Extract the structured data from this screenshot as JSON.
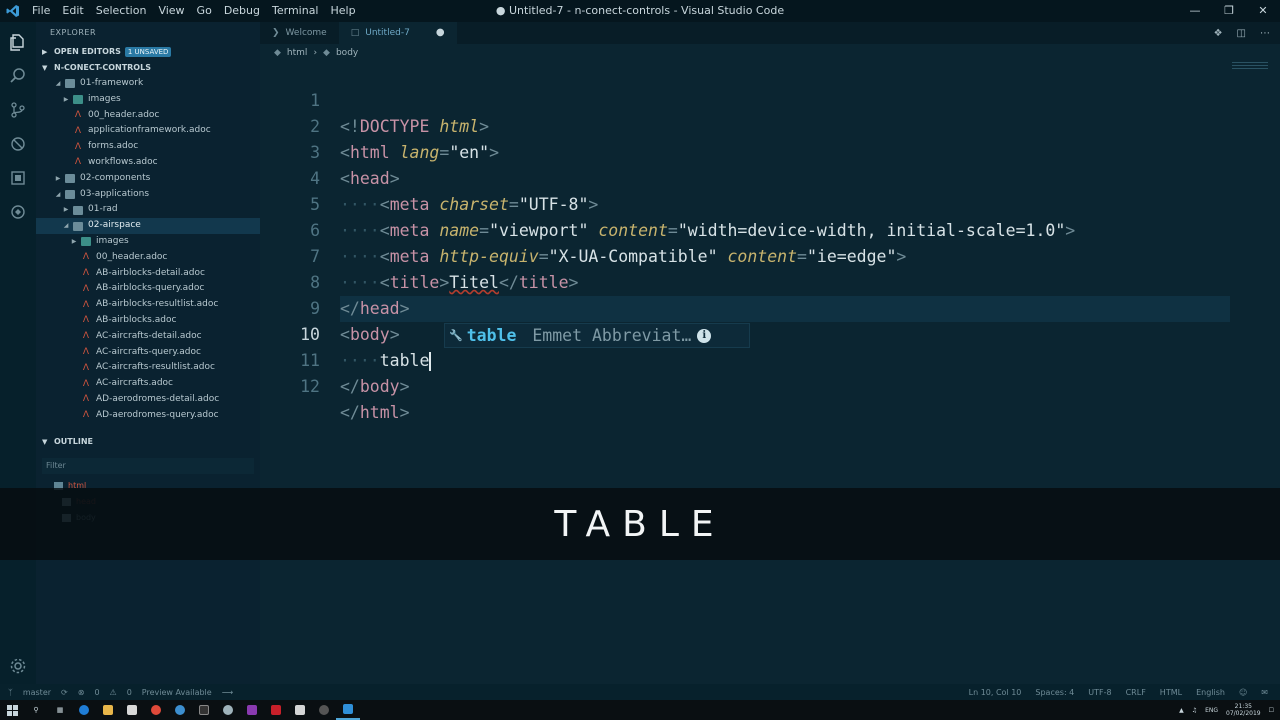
{
  "window": {
    "title": "● Untitled-7 - n-conect-controls - Visual Studio Code",
    "menu": [
      "File",
      "Edit",
      "Selection",
      "View",
      "Go",
      "Debug",
      "Terminal",
      "Help"
    ]
  },
  "sidebar": {
    "header": "EXPLORER",
    "open_editors": "OPEN EDITORS",
    "unsaved_badge": "1 UNSAVED",
    "project": "N-CONECT-CONTROLS",
    "tree": [
      {
        "label": "01-framework",
        "kind": "folder",
        "level": 1,
        "expanded": true
      },
      {
        "label": "images",
        "kind": "img-folder",
        "level": 2,
        "expanded": false
      },
      {
        "label": "00_header.adoc",
        "kind": "adoc",
        "level": 2
      },
      {
        "label": "applicationframework.adoc",
        "kind": "adoc",
        "level": 2
      },
      {
        "label": "forms.adoc",
        "kind": "adoc",
        "level": 2
      },
      {
        "label": "workflows.adoc",
        "kind": "adoc",
        "level": 2
      },
      {
        "label": "02-components",
        "kind": "folder",
        "level": 1,
        "expanded": false
      },
      {
        "label": "03-applications",
        "kind": "folder",
        "level": 1,
        "expanded": true
      },
      {
        "label": "01-rad",
        "kind": "folder",
        "level": 2,
        "expanded": false
      },
      {
        "label": "02-airspace",
        "kind": "folder",
        "level": 2,
        "expanded": true,
        "selected": true
      },
      {
        "label": "images",
        "kind": "img-folder",
        "level": 3,
        "expanded": false
      },
      {
        "label": "00_header.adoc",
        "kind": "adoc",
        "level": 3
      },
      {
        "label": "AB-airblocks-detail.adoc",
        "kind": "adoc",
        "level": 3
      },
      {
        "label": "AB-airblocks-query.adoc",
        "kind": "adoc",
        "level": 3
      },
      {
        "label": "AB-airblocks-resultlist.adoc",
        "kind": "adoc",
        "level": 3
      },
      {
        "label": "AB-airblocks.adoc",
        "kind": "adoc",
        "level": 3
      },
      {
        "label": "AC-aircrafts-detail.adoc",
        "kind": "adoc",
        "level": 3
      },
      {
        "label": "AC-aircrafts-query.adoc",
        "kind": "adoc",
        "level": 3
      },
      {
        "label": "AC-aircrafts-resultlist.adoc",
        "kind": "adoc",
        "level": 3
      },
      {
        "label": "AC-aircrafts.adoc",
        "kind": "adoc",
        "level": 3
      },
      {
        "label": "AD-aerodromes-detail.adoc",
        "kind": "adoc",
        "level": 3
      },
      {
        "label": "AD-aerodromes-query.adoc",
        "kind": "adoc",
        "level": 3
      }
    ],
    "outline": {
      "title": "OUTLINE",
      "filter_placeholder": "Filter",
      "items": [
        {
          "label": "html",
          "level": 1,
          "color": "#d0553f"
        },
        {
          "label": "head",
          "level": 2,
          "color": "#5a3a38"
        },
        {
          "label": "body",
          "level": 2,
          "color": "#4f6f7b"
        }
      ]
    }
  },
  "tabs": [
    {
      "label": "Welcome",
      "active": false
    },
    {
      "label": "Untitled-7",
      "active": true,
      "dirty": true
    }
  ],
  "breadcrumb": [
    "html",
    "body"
  ],
  "editor": {
    "current_line": 10,
    "line_numbers": [
      "1",
      "2",
      "3",
      "4",
      "5",
      "6",
      "7",
      "8",
      "9",
      "10",
      "11",
      "12"
    ],
    "suggestion": {
      "label": "table",
      "detail": "Emmet Abbreviat…"
    }
  },
  "caption": "TABLE",
  "statusbar": {
    "branch": "master",
    "errors": "0",
    "warnings": "0",
    "preview": "Preview Available",
    "position": "Ln 10, Col 10",
    "spaces": "Spaces: 4",
    "encoding": "UTF-8",
    "eol": "CRLF",
    "language": "HTML",
    "locale": "English"
  },
  "taskbar": {
    "lang": "ENG",
    "time": "21:35",
    "date": "07/02/2019"
  },
  "colors": {
    "accent": "#4fc0ea",
    "background": "#0b2531",
    "sidebar": "#0a2230",
    "error": "#d0553f"
  }
}
